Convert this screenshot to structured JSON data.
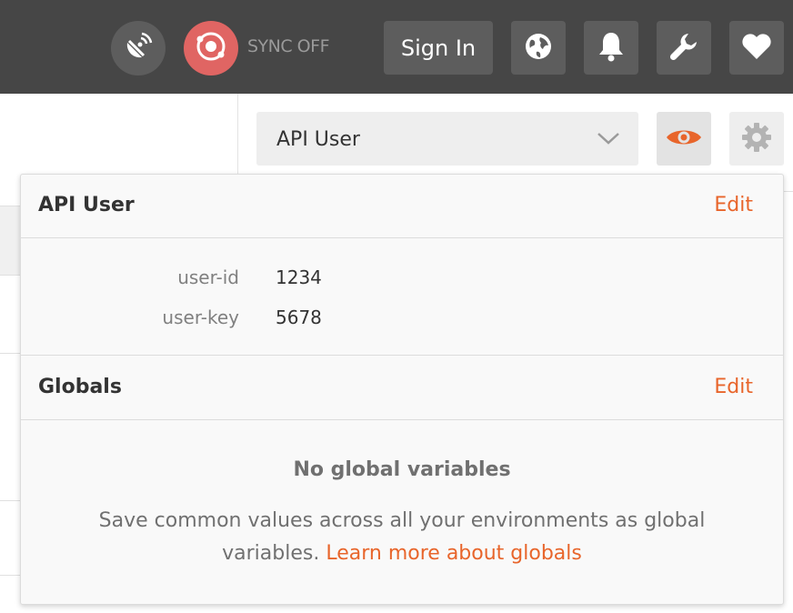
{
  "colors": {
    "topbar": "#464646",
    "sync_button": "#e06563",
    "accent": "#e8652b",
    "popover_bg": "#f9f9f9"
  },
  "topbar": {
    "interceptor_icon": "satellite-icon",
    "sync_icon": "sync-orbit-icon",
    "sync_label": "SYNC OFF",
    "sign_in_label": "Sign In",
    "icons": [
      "world-icon",
      "bell-icon",
      "wrench-icon",
      "heart-icon"
    ]
  },
  "environment": {
    "selected": "API User",
    "dropdown_icon": "chevron-down-icon",
    "quick_look_icon": "eye-icon",
    "settings_icon": "gear-icon"
  },
  "quick_look": {
    "environment": {
      "title": "API User",
      "edit_label": "Edit",
      "variables": [
        {
          "key": "user-id",
          "value": "1234"
        },
        {
          "key": "user-key",
          "value": "5678"
        }
      ]
    },
    "globals": {
      "title": "Globals",
      "edit_label": "Edit",
      "empty_title": "No global variables",
      "empty_desc": "Save common values across all your environments as global variables.",
      "learn_more_label": "Learn more about globals"
    }
  }
}
